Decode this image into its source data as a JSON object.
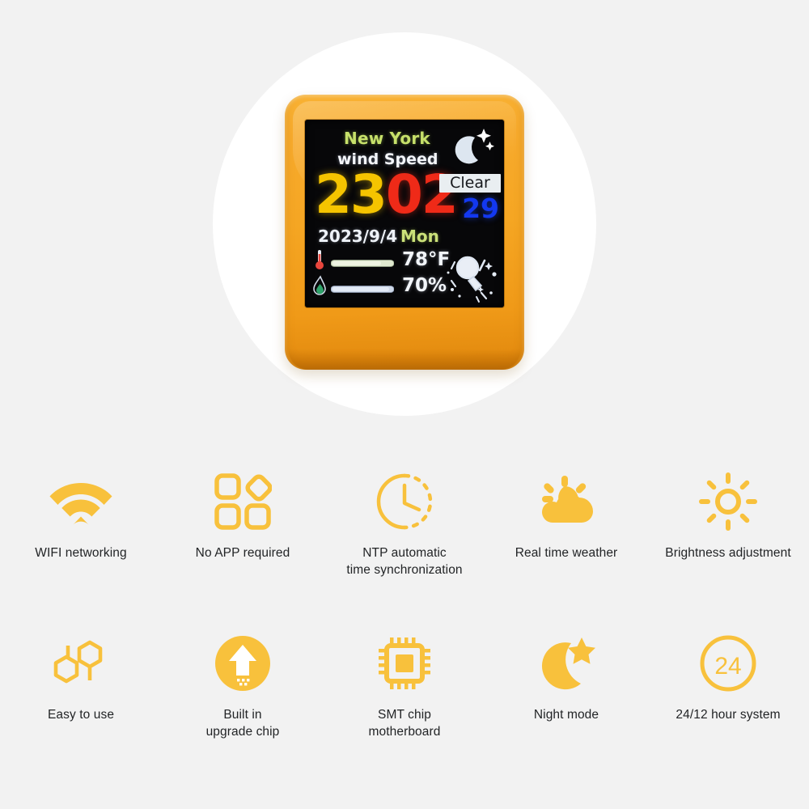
{
  "background_color": "#f2f2f2",
  "accent_color": "#f8c13c",
  "device": {
    "body_color": "#f5a623",
    "screen_background": "#070709",
    "display": {
      "city": "New York",
      "subtitle": "wind Speed",
      "moon_icon": "moon-stars-icon",
      "time_hours": "23",
      "time_minutes": "02",
      "condition": "Clear",
      "condition_temp": "29",
      "date": "2023/9/4",
      "weekday": "Mon",
      "temperature_icon": "thermometer-icon",
      "temperature_value": "78°F",
      "humidity_icon": "humidity-drop-icon",
      "humidity_value": "70%",
      "weather_icon": "wind-sparkle-icon",
      "colors": {
        "city": "#c6e06a",
        "subtitle": "#f3f5fa",
        "hours": "#f5c400",
        "minutes": "#ef2a18",
        "condition_bg": "#e9eef1",
        "condition_text": "#16181c",
        "condition_temp": "#1338f0",
        "date": "#eef2f8",
        "weekday": "#cbe179"
      }
    }
  },
  "features": {
    "row1": [
      {
        "icon": "wifi-icon",
        "label": "WIFI networking"
      },
      {
        "icon": "app-grid-icon",
        "label": "No APP required"
      },
      {
        "icon": "clock-sync-icon",
        "label": "NTP automatic\ntime synchronization"
      },
      {
        "icon": "sun-cloud-icon",
        "label": "Real time weather"
      },
      {
        "icon": "brightness-icon",
        "label": "Brightness adjustment"
      }
    ],
    "row2": [
      {
        "icon": "hexagons-icon",
        "label": "Easy to use"
      },
      {
        "icon": "upgrade-arrow-icon",
        "label": "Built in\nupgrade chip"
      },
      {
        "icon": "chip-icon",
        "label": "SMT chip\nmotherboard"
      },
      {
        "icon": "moon-star-icon",
        "label": "Night mode"
      },
      {
        "icon": "hour24-icon",
        "label": "24/12 hour system"
      }
    ]
  }
}
